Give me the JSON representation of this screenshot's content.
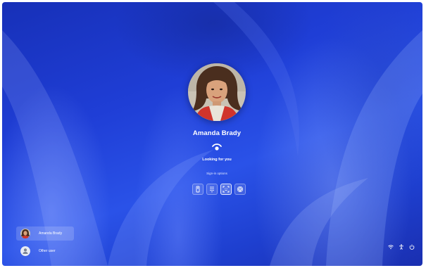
{
  "lock_screen": {
    "user_name": "Amanda Brady",
    "status_text": "Looking for you",
    "sign_in_options_link": "Sign-in options",
    "sign_in_options": [
      {
        "icon": "security-key-icon",
        "selected": false
      },
      {
        "icon": "pin-keypad-icon",
        "selected": false
      },
      {
        "icon": "face-recognition-icon",
        "selected": true
      },
      {
        "icon": "fingerprint-icon",
        "selected": false
      }
    ]
  },
  "user_switcher": {
    "users": [
      {
        "label": "Amanda Brady",
        "active": true,
        "avatar": "photo"
      },
      {
        "label": "Other user",
        "active": false,
        "avatar": "generic-person-icon"
      }
    ]
  },
  "system_tray": [
    "wifi-icon",
    "accessibility-icon",
    "power-icon"
  ],
  "colors": {
    "background_primary": "#1f3ed6",
    "background_dark": "#1730b8",
    "text": "#ffffff"
  }
}
